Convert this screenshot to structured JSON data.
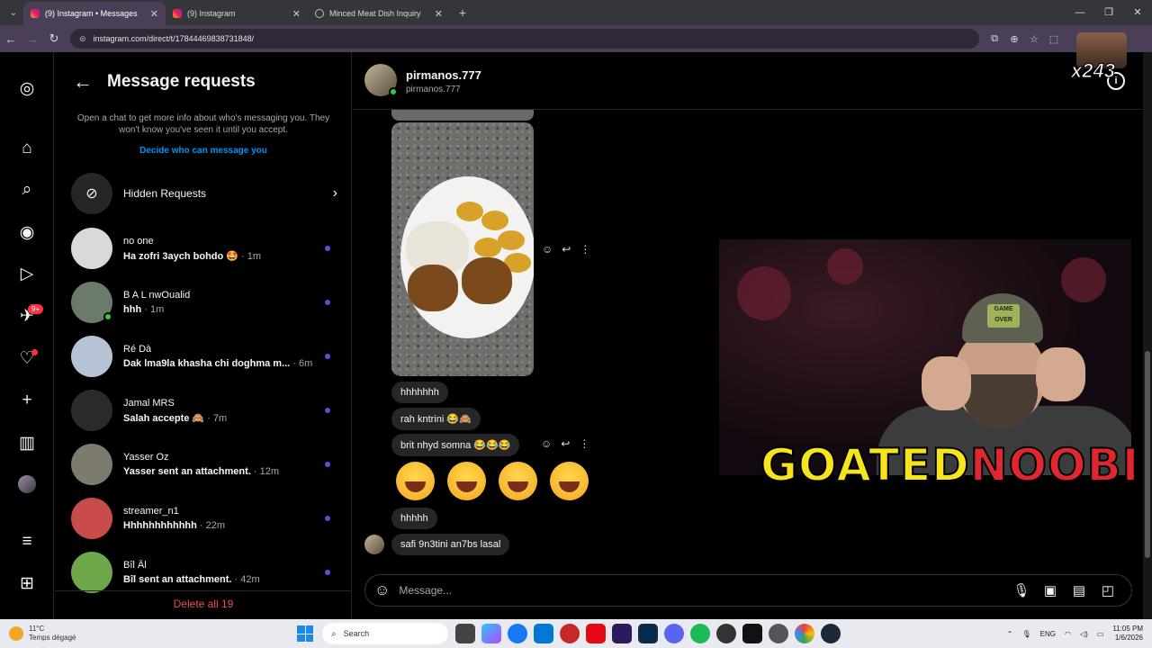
{
  "browser": {
    "tabs": [
      {
        "title": "(9) Instagram • Messages",
        "active": true
      },
      {
        "title": "(9) Instagram",
        "active": false
      },
      {
        "title": "Minced Meat Dish Inquiry",
        "active": false
      }
    ],
    "url": "instagram.com/direct/t/17844469838731848/"
  },
  "rail": {
    "notifications_badge": "9+"
  },
  "sidebar": {
    "title": "Message requests",
    "description": "Open a chat to get more info about who's messaging you. They won't know you've seen it until you accept.",
    "link": "Decide who can message you",
    "hidden_requests": "Hidden Requests",
    "conversations": [
      {
        "name": "no one",
        "preview": "Ha zofri 3aych bohdo 🤩",
        "time": "· 1m",
        "avatar_color": "#d9d9d9"
      },
      {
        "name": "B A L nwOualid",
        "preview": "hhh",
        "time": "· 1m",
        "avatar_color": "#6b7a6a"
      },
      {
        "name": "Ré Dà",
        "preview": "Dak lma9la khasha chi doghma m...",
        "time": "· 6m",
        "avatar_color": "#b7c4d6"
      },
      {
        "name": "Jamal MRS",
        "preview": "Salah accepte 🙈",
        "time": "· 7m",
        "avatar_color": "#2a2a2a"
      },
      {
        "name": "Yasser Oz",
        "preview": "Yasser sent an attachment.",
        "time": "· 12m",
        "avatar_color": "#7d7a6e"
      },
      {
        "name": "streamer_n1",
        "preview": "Hhhhhhhhhhhh",
        "time": "· 22m",
        "avatar_color": "#c94b4b"
      },
      {
        "name": "Bîl Âl",
        "preview": "Bîl sent an attachment.",
        "time": "· 42m",
        "avatar_color": "#6fa84a"
      }
    ],
    "delete_all": "Delete all 19"
  },
  "chat": {
    "name": "pirmanos.777",
    "username": "pirmanos.777",
    "messages": [
      {
        "text": "hhhhhhh"
      },
      {
        "text": "rah kntrini 😂🙈"
      },
      {
        "text": "brit nhyd somna 😂😂😂"
      },
      {
        "text": "hhhhh"
      },
      {
        "text": "safi 9n3tini an7bs lasal"
      }
    ],
    "composer_placeholder": "Message..."
  },
  "overlay": {
    "logo_part1": "GOATED",
    "logo_part2": "NOOBIE",
    "hat_text": "GAME OVER",
    "tag": "x243"
  },
  "taskbar": {
    "weather_temp": "11°C",
    "weather_desc": "Temps dégagé",
    "search": "Search",
    "lang": "ENG",
    "time": "11:05 PM",
    "date": "1/6/2026"
  }
}
